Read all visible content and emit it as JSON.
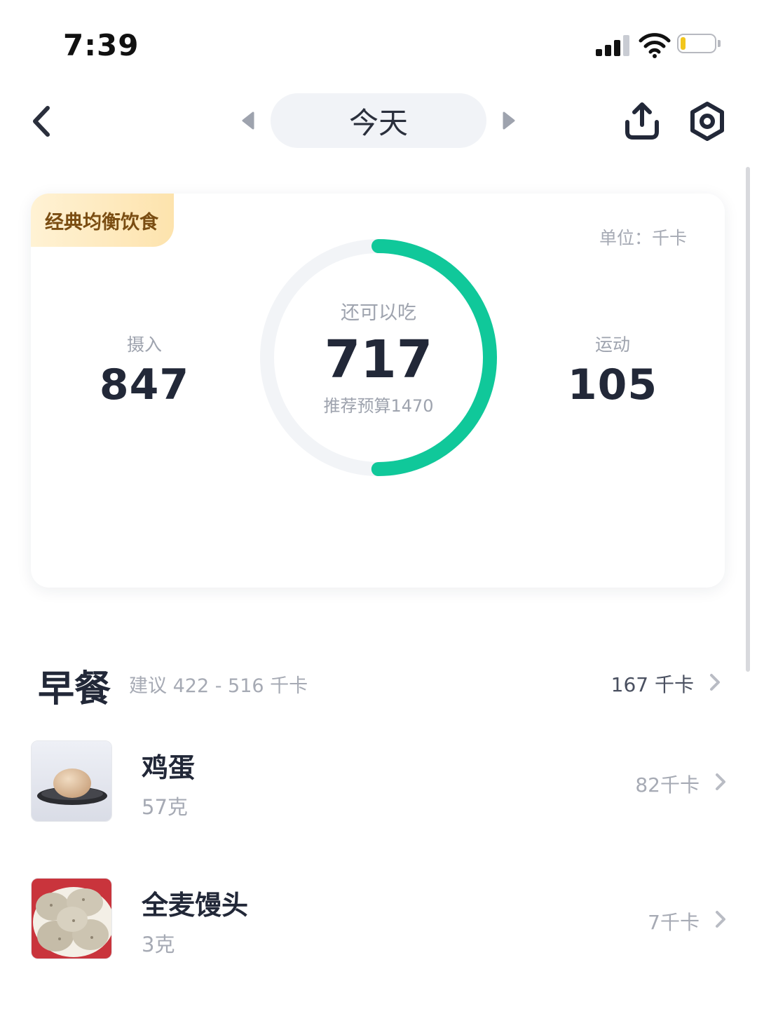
{
  "status_bar": {
    "time": "7:39",
    "battery_level": 0.15,
    "battery_color": "#f2c61c"
  },
  "header": {
    "date_label": "今天",
    "icons": [
      "back-icon",
      "prev-day-icon",
      "next-day-icon",
      "share-icon",
      "settings-icon"
    ]
  },
  "summary": {
    "diet_tag": "经典均衡饮食",
    "unit": "单位：千卡",
    "intake_label": "摄入",
    "intake_value": "847",
    "remaining_label": "还可以吃",
    "remaining_value": "717",
    "budget_text": "推荐预算1470",
    "exercise_label": "运动",
    "exercise_value": "105",
    "ring_progress": 0.5,
    "ring_color": "#10c89a",
    "ring_track_color": "#f2f4f7"
  },
  "meal": {
    "title": "早餐",
    "suggestion": "建议 422 - 516 千卡",
    "total": "167 千卡",
    "foods": [
      {
        "name": "鸡蛋",
        "qty": "57克",
        "kcal": "82千卡",
        "image": "egg-photo"
      },
      {
        "name": "全麦馒头",
        "qty": "3克",
        "kcal": "7千卡",
        "image": "steamed-bun-photo"
      }
    ]
  }
}
